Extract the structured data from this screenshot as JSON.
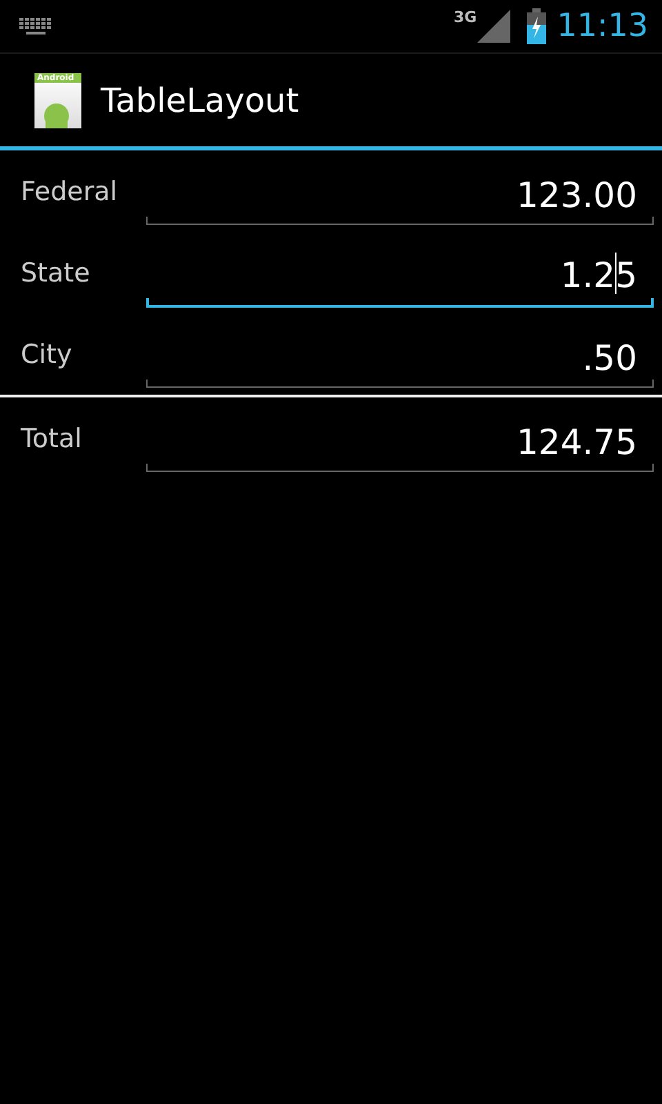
{
  "status_bar": {
    "network": "3G",
    "time": "11:13"
  },
  "action_bar": {
    "icon_label": "Android",
    "title": "TableLayout"
  },
  "rows": [
    {
      "label": "Federal",
      "value": "123.00",
      "focused": false,
      "divider_after": false
    },
    {
      "label": "State",
      "value": "1.25",
      "focused": true,
      "divider_after": false
    },
    {
      "label": "City",
      "value": ".50",
      "focused": false,
      "divider_after": true
    },
    {
      "label": "Total",
      "value": "124.75",
      "focused": false,
      "divider_after": false
    }
  ]
}
